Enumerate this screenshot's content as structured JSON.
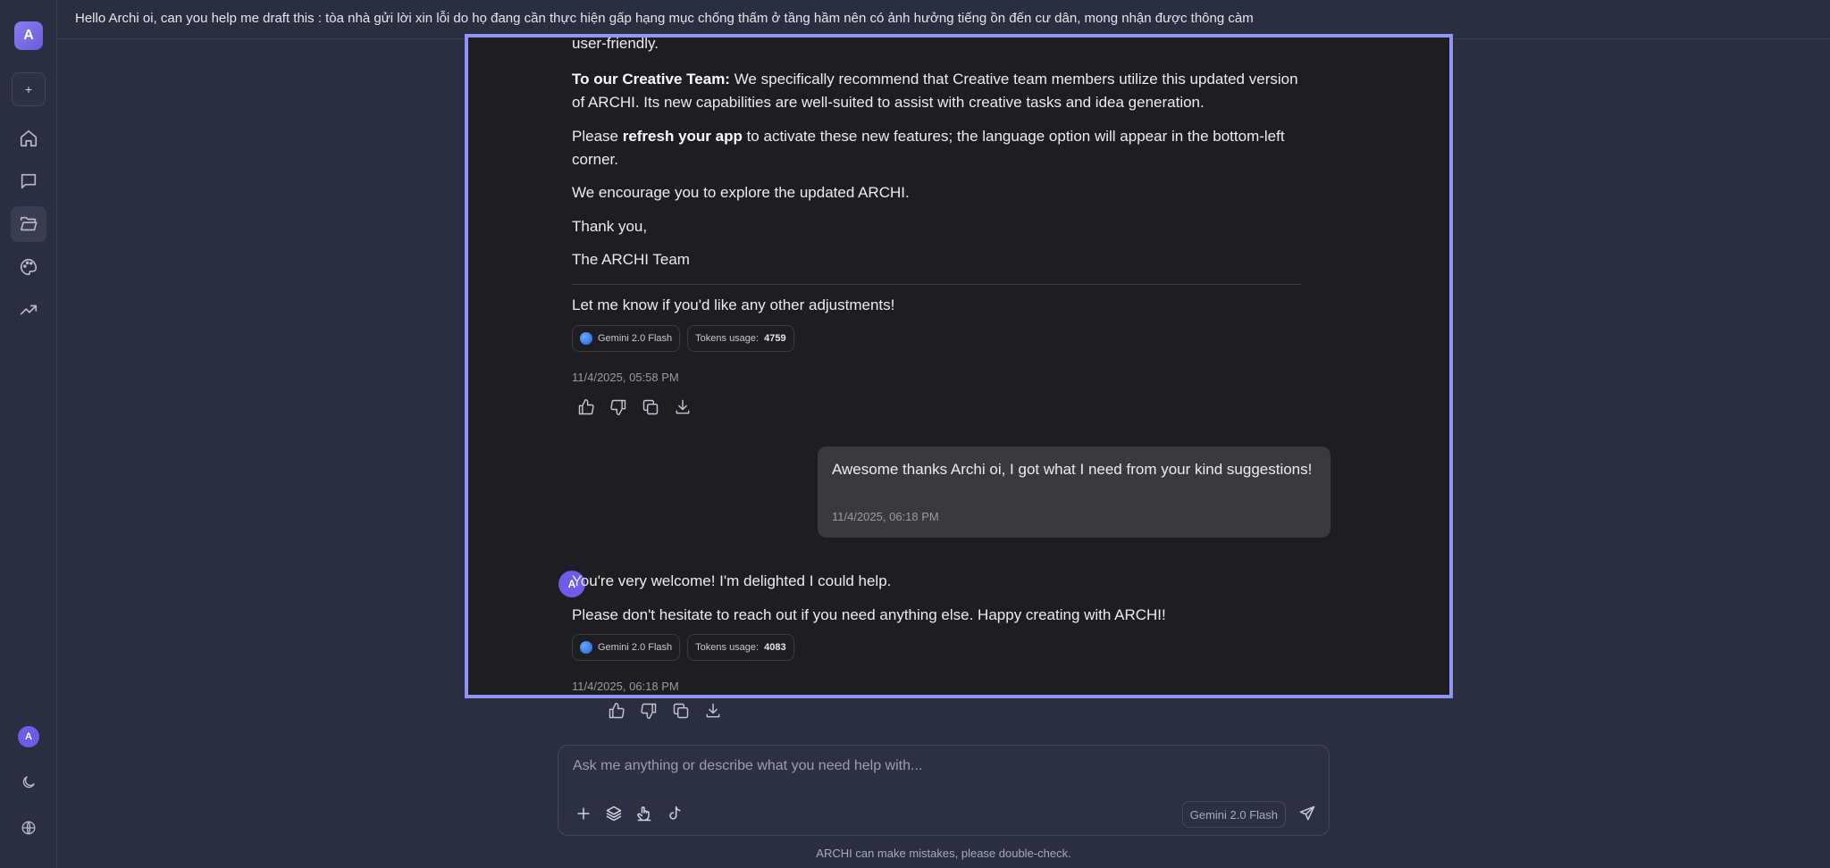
{
  "sidebar": {
    "logo_letter": "A",
    "new_label": "+",
    "nav": [
      "home-icon",
      "chat-icon",
      "folder-open-icon",
      "palette-icon",
      "trending-up-icon"
    ],
    "user_initial": "A",
    "bottom": [
      "moon-icon",
      "globe-icon"
    ]
  },
  "header": {
    "title": "Hello Archi oi, can you help me draft this : tòa nhà gửi lời xin lỗi do họ đang cần thực hiện gấp hạng mục chống thấm ở tầng hầm nên có ảnh hưởng tiếng ồn đến cư dân, mong nhận được thông càm"
  },
  "chat": {
    "assistant_prev": {
      "p0": "user-friendly.",
      "p1_bold": "To our Creative Team:",
      "p1_rest": " We specifically recommend that Creative team members utilize this updated version of ARCHI. Its new capabilities are well-suited to assist with creative tasks and idea generation.",
      "p2_pre": "Please ",
      "p2_bold": "refresh your app",
      "p2_post": " to activate these new features; the language option will appear in the bottom-left corner.",
      "p3": "We encourage you to explore the updated ARCHI.",
      "p4": "Thank you,",
      "p5": "The ARCHI Team",
      "p6": "Let me know if you'd like any other adjustments!",
      "model": "Gemini 2.0 Flash",
      "tokens_label": "Tokens usage:",
      "tokens": "4759",
      "timestamp": "11/4/2025, 05:58 PM"
    },
    "user_msg": {
      "text": "Awesome thanks Archi oi, I got what I need from your kind suggestions!",
      "timestamp": "11/4/2025, 06:18 PM"
    },
    "assistant_last": {
      "avatar": "A",
      "p1": "You're very welcome! I'm delighted I could help.",
      "p2": "Please don't hesitate to reach out if you need anything else. Happy creating with ARCHI!",
      "model": "Gemini 2.0 Flash",
      "tokens_label": "Tokens usage:",
      "tokens": "4083",
      "timestamp": "11/4/2025, 06:18 PM"
    },
    "action_icons": [
      "thumbs-up-icon",
      "thumbs-down-icon",
      "copy-icon",
      "download-icon"
    ]
  },
  "composer": {
    "placeholder": "Ask me anything or describe what you need help with...",
    "model": "Gemini 2.0 Flash",
    "tools": [
      "plus-icon",
      "layers-icon",
      "hand-pointer-icon",
      "tiktok-icon"
    ],
    "send_icon": "send-icon"
  },
  "footer": {
    "disclaimer": "ARCHI can make mistakes, please double-check."
  },
  "colors": {
    "accent_border": "#8f95f2",
    "avatar": "#6c5ce7",
    "background": "#2b2d40",
    "panel": "#1e1e22"
  }
}
